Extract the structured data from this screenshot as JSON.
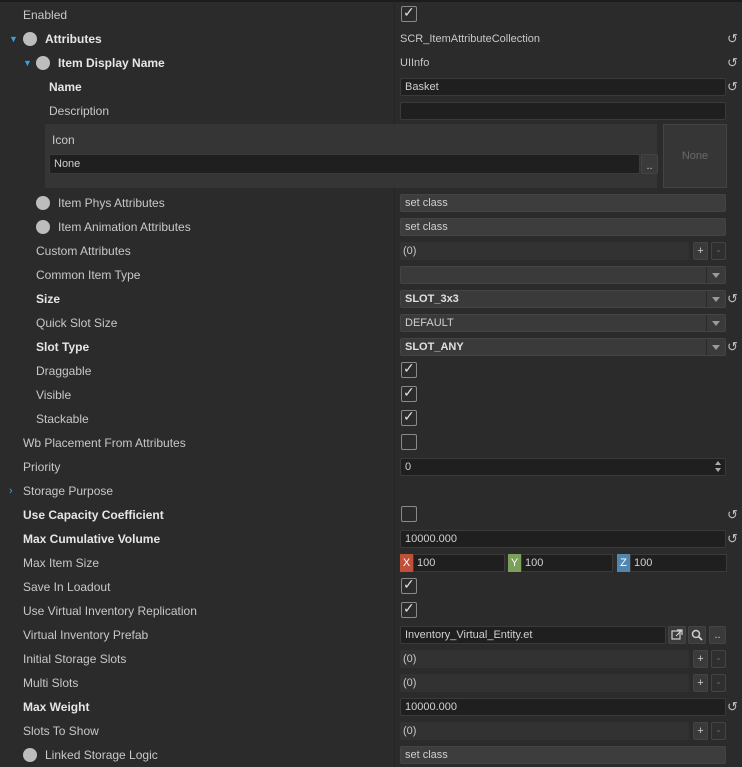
{
  "rows": {
    "enabled": {
      "label": "Enabled",
      "checked": true
    },
    "attributes": {
      "label": "Attributes",
      "value": "SCR_ItemAttributeCollection"
    },
    "item_display_name": {
      "label": "Item Display Name",
      "value": "UIInfo"
    },
    "name": {
      "label": "Name",
      "value": "Basket"
    },
    "description": {
      "label": "Description",
      "value": ""
    },
    "icon": {
      "label": "Icon",
      "value": "None",
      "browse_label": "..",
      "thumb_label": "None"
    },
    "item_phys_attributes": {
      "label": "Item Phys Attributes",
      "value": "set class"
    },
    "item_animation_attributes": {
      "label": "Item Animation Attributes",
      "value": "set class"
    },
    "custom_attributes": {
      "label": "Custom Attributes",
      "value": "(0)"
    },
    "common_item_type": {
      "label": "Common Item Type",
      "value": ""
    },
    "size": {
      "label": "Size",
      "value": "SLOT_3x3"
    },
    "quick_slot_size": {
      "label": "Quick Slot Size",
      "value": "DEFAULT"
    },
    "slot_type": {
      "label": "Slot Type",
      "value": "SLOT_ANY"
    },
    "draggable": {
      "label": "Draggable",
      "checked": true
    },
    "visible": {
      "label": "Visible",
      "checked": true
    },
    "stackable": {
      "label": "Stackable",
      "checked": true
    },
    "wb_placement": {
      "label": "Wb Placement From Attributes",
      "checked": false
    },
    "priority": {
      "label": "Priority",
      "value": "0"
    },
    "storage_purpose": {
      "label": "Storage Purpose"
    },
    "use_capacity_coefficient": {
      "label": "Use Capacity Coefficient",
      "checked": false
    },
    "max_cumulative_volume": {
      "label": "Max Cumulative Volume",
      "value": "10000.000"
    },
    "max_item_size": {
      "label": "Max Item Size",
      "x_label": "X",
      "x": "100",
      "y_label": "Y",
      "y": "100",
      "z_label": "Z",
      "z": "100"
    },
    "save_in_loadout": {
      "label": "Save In Loadout",
      "checked": true
    },
    "use_virtual_inventory_replication": {
      "label": "Use Virtual Inventory Replication",
      "checked": true
    },
    "virtual_inventory_prefab": {
      "label": "Virtual Inventory Prefab",
      "value": "Inventory_Virtual_Entity.et",
      "browse_label": ".."
    },
    "initial_storage_slots": {
      "label": "Initial Storage Slots",
      "value": "(0)"
    },
    "multi_slots": {
      "label": "Multi Slots",
      "value": "(0)"
    },
    "max_weight": {
      "label": "Max Weight",
      "value": "10000.000"
    },
    "slots_to_show": {
      "label": "Slots To Show",
      "value": "(0)"
    },
    "linked_storage_logic": {
      "label": "Linked Storage Logic",
      "value": "set class"
    }
  },
  "glyphs": {
    "check": "✓",
    "reset": "↺",
    "add": "+",
    "remove": "-",
    "expanded": "▼",
    "collapsed": "›"
  },
  "colors": {
    "accent": "#3aa0e0",
    "axis_x": "#c0503a",
    "axis_y": "#7aa05a",
    "axis_z": "#4f87b0"
  }
}
